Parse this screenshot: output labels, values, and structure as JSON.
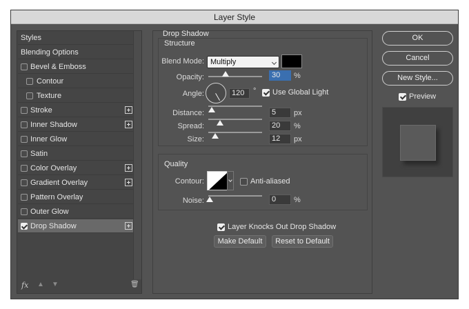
{
  "window": {
    "title": "Layer Style"
  },
  "styles_panel": {
    "items": [
      {
        "label": "Styles",
        "checkbox": false,
        "plus": false,
        "indent": false,
        "checked": false
      },
      {
        "label": "Blending Options",
        "checkbox": false,
        "plus": false,
        "indent": false,
        "checked": false
      },
      {
        "label": "Bevel & Emboss",
        "checkbox": true,
        "plus": false,
        "indent": false,
        "checked": false
      },
      {
        "label": "Contour",
        "checkbox": true,
        "plus": false,
        "indent": true,
        "checked": false
      },
      {
        "label": "Texture",
        "checkbox": true,
        "plus": false,
        "indent": true,
        "checked": false
      },
      {
        "label": "Stroke",
        "checkbox": true,
        "plus": true,
        "indent": false,
        "checked": false
      },
      {
        "label": "Inner Shadow",
        "checkbox": true,
        "plus": true,
        "indent": false,
        "checked": false
      },
      {
        "label": "Inner Glow",
        "checkbox": true,
        "plus": false,
        "indent": false,
        "checked": false
      },
      {
        "label": "Satin",
        "checkbox": true,
        "plus": false,
        "indent": false,
        "checked": false
      },
      {
        "label": "Color Overlay",
        "checkbox": true,
        "plus": true,
        "indent": false,
        "checked": false
      },
      {
        "label": "Gradient Overlay",
        "checkbox": true,
        "plus": true,
        "indent": false,
        "checked": false
      },
      {
        "label": "Pattern Overlay",
        "checkbox": true,
        "plus": false,
        "indent": false,
        "checked": false
      },
      {
        "label": "Outer Glow",
        "checkbox": true,
        "plus": false,
        "indent": false,
        "checked": false
      },
      {
        "label": "Drop Shadow",
        "checkbox": true,
        "plus": true,
        "indent": false,
        "checked": true
      }
    ],
    "footer": {
      "fx_label": "fx"
    }
  },
  "drop_shadow": {
    "title": "Drop Shadow",
    "structure": {
      "title": "Structure",
      "blend_mode_label": "Blend Mode:",
      "blend_mode_value": "Multiply",
      "shadow_color": "#000000",
      "opacity_label": "Opacity:",
      "opacity_value": "30",
      "opacity_unit": "%",
      "angle_label": "Angle:",
      "angle_value": "120",
      "angle_unit": "°",
      "global_light_label": "Use Global Light",
      "global_light_checked": true,
      "distance_label": "Distance:",
      "distance_value": "5",
      "distance_unit": "px",
      "spread_label": "Spread:",
      "spread_value": "20",
      "spread_unit": "%",
      "size_label": "Size:",
      "size_value": "12",
      "size_unit": "px"
    },
    "quality": {
      "title": "Quality",
      "contour_label": "Contour:",
      "anti_aliased_label": "Anti-aliased",
      "anti_aliased_checked": false,
      "noise_label": "Noise:",
      "noise_value": "0",
      "noise_unit": "%"
    },
    "knockout_label": "Layer Knocks Out Drop Shadow",
    "knockout_checked": true,
    "make_default_label": "Make Default",
    "reset_default_label": "Reset to Default"
  },
  "right_panel": {
    "ok_label": "OK",
    "cancel_label": "Cancel",
    "new_style_label": "New Style...",
    "preview_label": "Preview",
    "preview_checked": true
  }
}
